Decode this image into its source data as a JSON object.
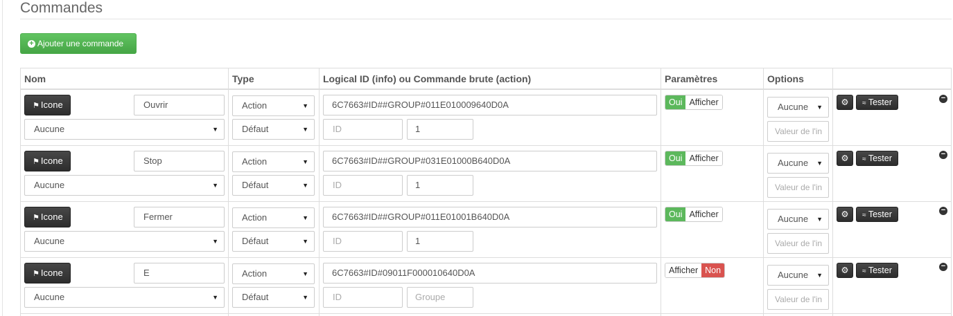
{
  "section": {
    "title": "Commandes"
  },
  "add_button": {
    "label": "Ajouter une commande"
  },
  "table": {
    "headers": [
      "Nom",
      "Type",
      "Logical ID (info) ou Commande brute (action)",
      "Paramètres",
      "Options"
    ],
    "rows": [
      {
        "icone_label": "Icone",
        "name": "Ouvrir",
        "object": "Aucune",
        "type": "Action",
        "subtype": "Défaut",
        "logical_id": "6C7663#ID##GROUP#011E010009640D0A",
        "id_placeholder": "ID",
        "group": "1",
        "group_is_placeholder": false,
        "toggle_state": "oui",
        "toggle_oui": "Oui",
        "toggle_afficher": "Afficher",
        "option_select": "Aucune",
        "option_value_placeholder": "Valeur de l'in",
        "config_label": "",
        "tester_label": "Tester"
      },
      {
        "icone_label": "Icone",
        "name": "Stop",
        "object": "Aucune",
        "type": "Action",
        "subtype": "Défaut",
        "logical_id": "6C7663#ID##GROUP#031E01000B640D0A",
        "id_placeholder": "ID",
        "group": "1",
        "group_is_placeholder": false,
        "toggle_state": "oui",
        "toggle_oui": "Oui",
        "toggle_afficher": "Afficher",
        "option_select": "Aucune",
        "option_value_placeholder": "Valeur de l'in",
        "config_label": "",
        "tester_label": "Tester"
      },
      {
        "icone_label": "Icone",
        "name": "Fermer",
        "object": "Aucune",
        "type": "Action",
        "subtype": "Défaut",
        "logical_id": "6C7663#ID##GROUP#011E01001B640D0A",
        "id_placeholder": "ID",
        "group": "1",
        "group_is_placeholder": false,
        "toggle_state": "oui",
        "toggle_oui": "Oui",
        "toggle_afficher": "Afficher",
        "option_select": "Aucune",
        "option_value_placeholder": "Valeur de l'in",
        "config_label": "",
        "tester_label": "Tester"
      },
      {
        "icone_label": "Icone",
        "name": "E",
        "object": "Aucune",
        "type": "Action",
        "subtype": "Défaut",
        "logical_id": "6C7663#ID#09011F000010640D0A",
        "id_placeholder": "ID",
        "group": "Groupe",
        "group_is_placeholder": true,
        "toggle_state": "non",
        "toggle_non": "Non",
        "toggle_afficher": "Afficher",
        "option_select": "Aucune",
        "option_value_placeholder": "Valeur de l'in",
        "config_label": "",
        "tester_label": "Tester"
      }
    ]
  },
  "colors": {
    "success": "#5cb85c",
    "danger": "#d9534f",
    "dark_button": "#3a3a3a"
  },
  "icons": {
    "add": "plus-circle-icon",
    "icone": "flag-icon",
    "config": "gears-icon",
    "tester": "rss-icon",
    "remove": "minus-circle-icon"
  }
}
